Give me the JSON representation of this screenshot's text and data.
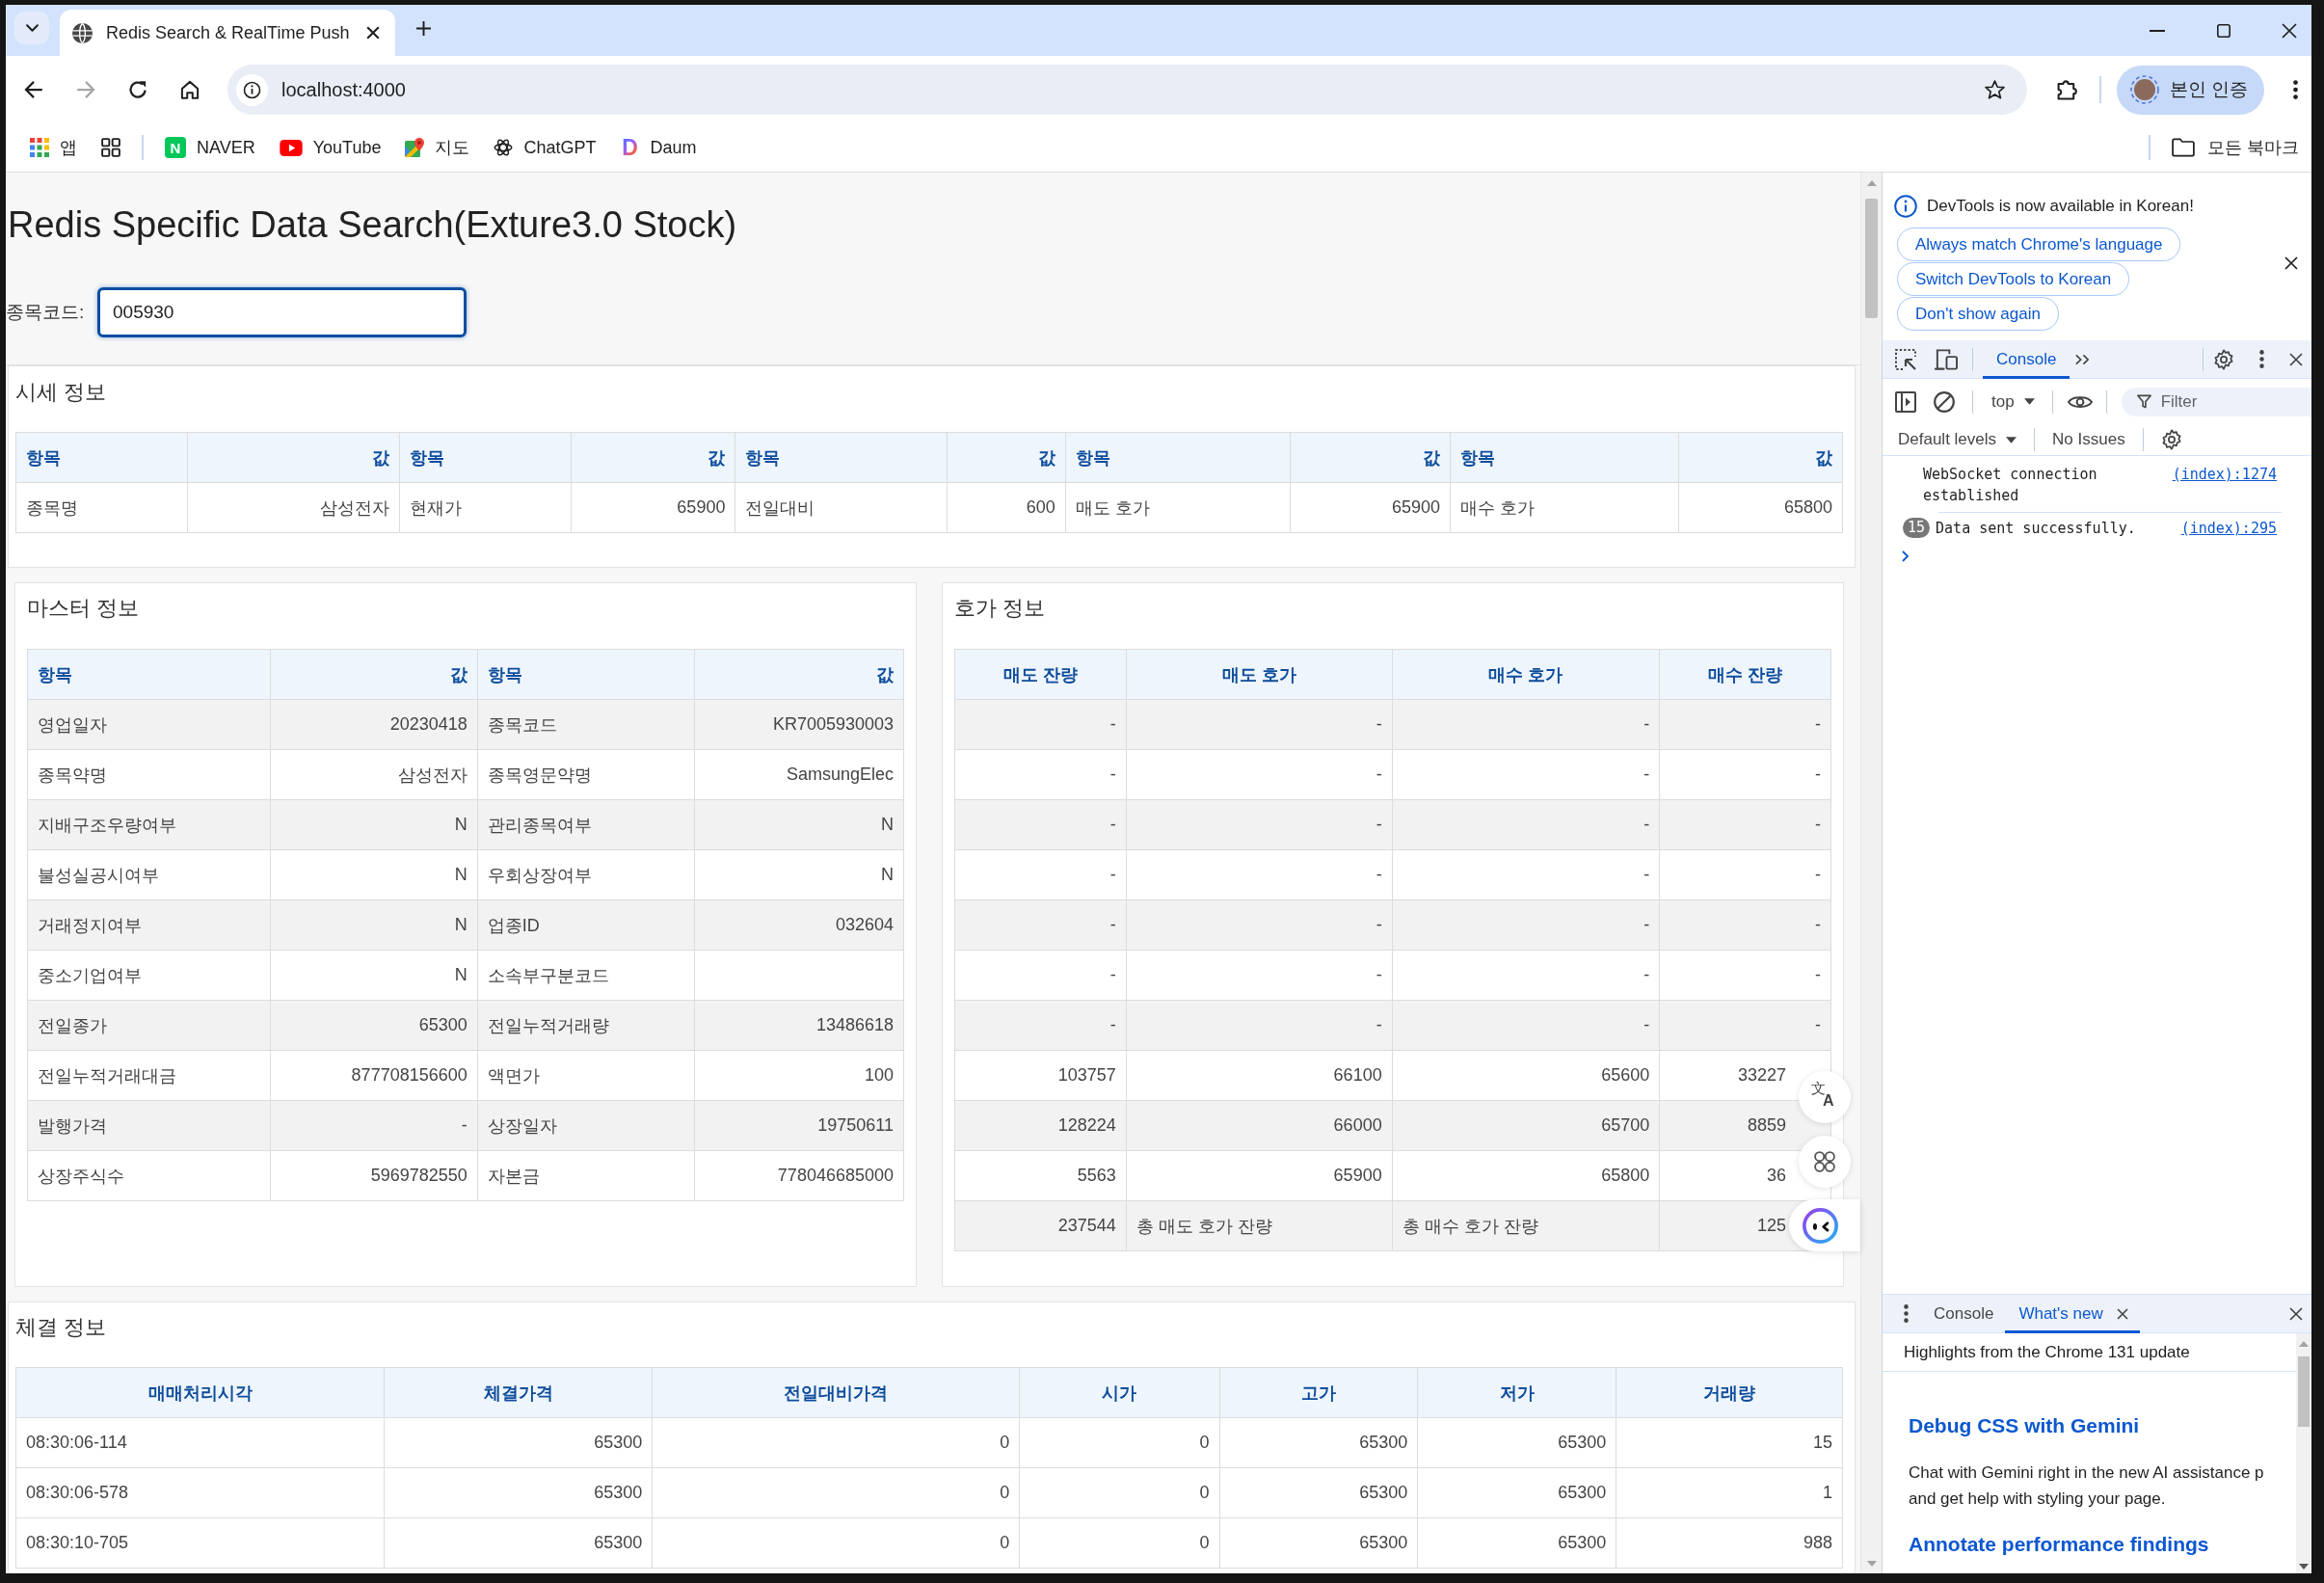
{
  "browser": {
    "tabs": [
      {
        "title": "Redis Search & RealTime Push",
        "selected": true
      }
    ],
    "address": "localhost:4000",
    "profile": "본인 인증",
    "bookmarks": [
      {
        "kind": "apps",
        "label": "앱"
      },
      {
        "kind": "naver",
        "mark": "N",
        "label": "NAVER"
      },
      {
        "kind": "video",
        "label": "YouTube"
      },
      {
        "kind": "map",
        "label": "지도"
      },
      {
        "kind": "chat",
        "label": "ChatGPT"
      },
      {
        "kind": "daum",
        "mark": "D",
        "label": "Daum"
      }
    ],
    "all_bookmarks": "모든 북마크"
  },
  "page": {
    "title": "Redis Specific Data Search(Exture3.0 Stock)",
    "search": {
      "label": "종목코드:",
      "value": "005930"
    },
    "quote": {
      "title": "시세 정보",
      "columns": [
        "항목",
        "값",
        "항목",
        "값",
        "항목",
        "값",
        "항목",
        "값",
        "항목",
        "값"
      ],
      "rows": [
        [
          "종목명",
          "삼성전자",
          "현재가",
          "65900",
          "전일대비",
          "600",
          "매도 호가",
          "65900",
          "매수 호가",
          "65800"
        ]
      ]
    },
    "master": {
      "title": "마스터 정보",
      "columns": [
        "항목",
        "값",
        "항목",
        "값"
      ],
      "rows": [
        [
          "영업일자",
          "20230418",
          "종목코드",
          "KR7005930003"
        ],
        [
          "종목약명",
          "삼성전자",
          "종목영문약명",
          "SamsungElec"
        ],
        [
          "지배구조우량여부",
          "N",
          "관리종목여부",
          "N"
        ],
        [
          "불성실공시여부",
          "N",
          "우회상장여부",
          "N"
        ],
        [
          "거래정지여부",
          "N",
          "업종ID",
          "032604"
        ],
        [
          "중소기업여부",
          "N",
          "소속부구분코드"
        ],
        [
          "전일종가",
          "65300",
          "전일누적거래량",
          "13486618"
        ],
        [
          "전일누적거래대금",
          "877708156600",
          "액면가",
          "100"
        ],
        [
          "발행가격",
          "-",
          "상장일자",
          "19750611"
        ],
        [
          "상장주식수",
          "5969782550",
          "자본금",
          "778046685000"
        ]
      ]
    },
    "orderbook": {
      "title": "호가 정보",
      "columns": [
        "매도 잔량",
        "매도 호가",
        "매수 호가",
        "매수 잔량"
      ],
      "rows": [
        {
          "kind": "level",
          "overlaid": false,
          "cells": [
            "-",
            "-",
            "-",
            "-"
          ]
        },
        {
          "kind": "level",
          "overlaid": false,
          "cells": [
            "-",
            "-",
            "-",
            "-"
          ]
        },
        {
          "kind": "level",
          "overlaid": false,
          "cells": [
            "-",
            "-",
            "-",
            "-"
          ]
        },
        {
          "kind": "level",
          "overlaid": false,
          "cells": [
            "-",
            "-",
            "-",
            "-"
          ]
        },
        {
          "kind": "level",
          "overlaid": false,
          "cells": [
            "-",
            "-",
            "-",
            "-"
          ]
        },
        {
          "kind": "level",
          "overlaid": false,
          "cells": [
            "-",
            "-",
            "-",
            "-"
          ]
        },
        {
          "kind": "level",
          "overlaid": false,
          "cells": [
            "-",
            "-",
            "-",
            "-"
          ]
        },
        {
          "kind": "level",
          "overlaid": true,
          "cells": [
            "103757",
            "66100",
            "65600",
            "33227"
          ]
        },
        {
          "kind": "level",
          "overlaid": true,
          "cells": [
            "128224",
            "66000",
            "65700",
            "8859"
          ]
        },
        {
          "kind": "level",
          "overlaid": true,
          "cells": [
            "5563",
            "65900",
            "65800",
            "36"
          ]
        },
        {
          "kind": "total",
          "overlaid": true,
          "cells": [
            "237544",
            "총 매도 호가 잔량",
            "총 매수 호가 잔량",
            "125"
          ]
        }
      ]
    },
    "trades": {
      "title": "체결 정보",
      "columns": [
        "매매처리시각",
        "체결가격",
        "전일대비가격",
        "시가",
        "고가",
        "저가",
        "거래량"
      ],
      "rows": [
        [
          "08:30:06-114",
          "65300",
          "0",
          "0",
          "65300",
          "65300",
          "15"
        ],
        [
          "08:30:06-578",
          "65300",
          "0",
          "0",
          "65300",
          "65300",
          "1"
        ],
        [
          "08:30:10-705",
          "65300",
          "0",
          "0",
          "65300",
          "65300",
          "988"
        ]
      ]
    },
    "overlay": {
      "translate_glyphs": [
        "文",
        "A"
      ]
    }
  },
  "devtools": {
    "infobar": {
      "message": "DevTools is now available in Korean!",
      "buttons": [
        "Always match Chrome's language",
        "Switch DevTools to Korean",
        "Don't show again"
      ]
    },
    "tabs": [
      {
        "label": "Console",
        "selected": true
      }
    ],
    "context": "top",
    "filter": {
      "placeholder": "Filter"
    },
    "levels": "Default levels",
    "issues": "No Issues",
    "messages": [
      {
        "text": "WebSocket connection established",
        "source": "(index):1274"
      },
      {
        "count": "15",
        "text": "Data sent successfully.",
        "source": "(index):295"
      }
    ],
    "drawer": {
      "tabs": [
        {
          "label": "Console",
          "selected": false,
          "closable": false
        },
        {
          "label": "What's new",
          "selected": true,
          "closable": true
        }
      ],
      "heading": "Highlights from the Chrome 131 update",
      "articles": [
        {
          "title": "Debug CSS with Gemini",
          "lines": [
            "Chat with Gemini right in the new AI assistance p",
            "and get help with styling your page."
          ]
        },
        {
          "title": "Annotate performance findings"
        }
      ]
    }
  }
}
